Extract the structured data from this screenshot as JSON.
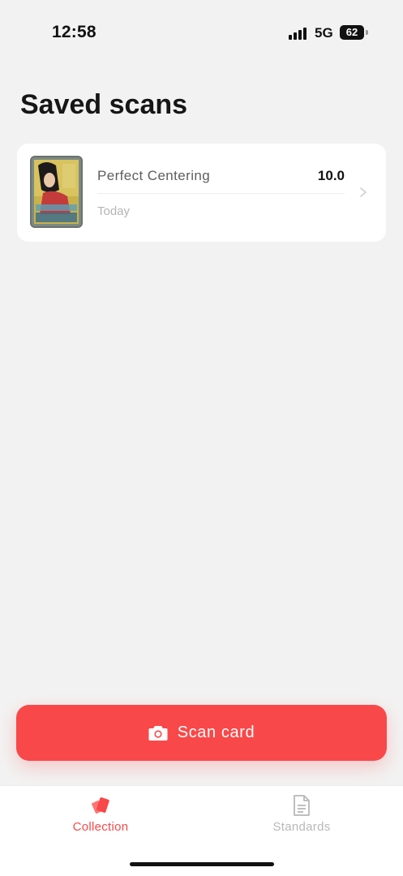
{
  "status_bar": {
    "time": "12:58",
    "network": "5G",
    "battery": "62",
    "signal_icon": "cellular-signal-icon"
  },
  "page": {
    "title": "Saved scans"
  },
  "scans": [
    {
      "name": "Perfect Centering",
      "score": "10.0",
      "date": "Today",
      "thumbnail_icon": "trading-card-thumbnail"
    }
  ],
  "actions": {
    "scan_label": "Scan card",
    "scan_icon": "camera-icon"
  },
  "tab_bar": {
    "tabs": [
      {
        "label": "Collection",
        "icon": "cards-icon",
        "active": true
      },
      {
        "label": "Standards",
        "icon": "document-icon",
        "active": false
      }
    ]
  },
  "colors": {
    "accent": "#f94849",
    "background": "#f3f2f2",
    "card_background": "#ffffff",
    "inactive_tab": "#b8b8b8"
  }
}
